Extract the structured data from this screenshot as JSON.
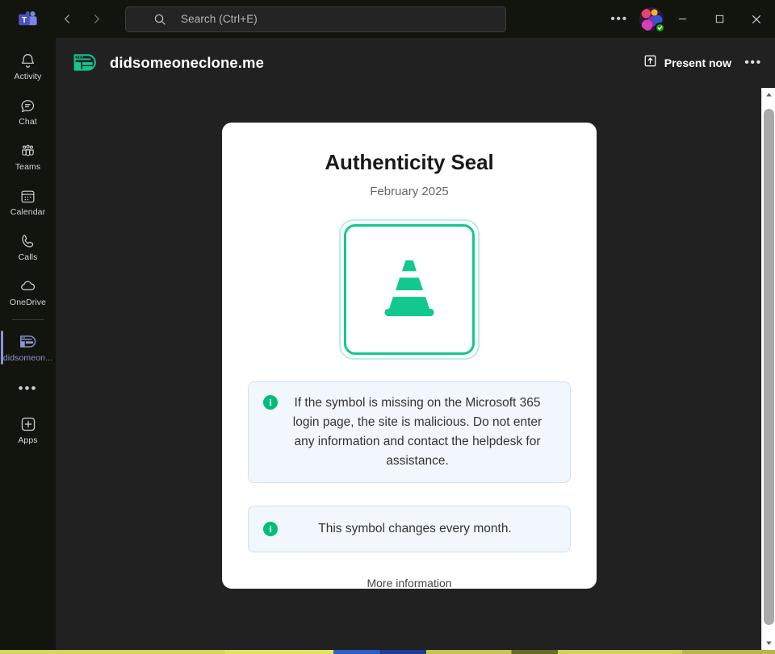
{
  "titlebar": {
    "app_logo": "teams-logo",
    "back_label": "‹",
    "forward_label": "›",
    "search_placeholder": "Search (Ctrl+E)",
    "search_value": "",
    "more_label": "•••",
    "presence_status": "available",
    "minimize_label": "─",
    "maximize_label": "□",
    "close_label": "✕"
  },
  "rail": {
    "items": [
      {
        "label": "Activity",
        "icon": "bell-icon",
        "active": false
      },
      {
        "label": "Chat",
        "icon": "chat-icon",
        "active": false
      },
      {
        "label": "Teams",
        "icon": "teams-icon",
        "active": false
      },
      {
        "label": "Calendar",
        "icon": "calendar-icon",
        "active": false
      },
      {
        "label": "Calls",
        "icon": "phone-icon",
        "active": false
      },
      {
        "label": "OneDrive",
        "icon": "cloud-icon",
        "active": false
      },
      {
        "label": "didsomeon...",
        "icon": "app-window-icon",
        "active": true
      }
    ],
    "more_label": "•••",
    "apps_label": "Apps",
    "accent_color": "#8f93d6"
  },
  "app_header": {
    "title": "didsomeoneclone.me",
    "icon": "app-window-icon",
    "present_label": "Present now",
    "present_icon": "share-up-icon",
    "more_label": "•••"
  },
  "card": {
    "title": "Authenticity Seal",
    "date": "February 2025",
    "seal": {
      "symbol_name": "traffic-cone-icon",
      "color": "#12c88f",
      "outer_border_color": "#b7f0dc"
    },
    "alerts": [
      {
        "icon": "info-icon",
        "icon_char": "i",
        "text": "If the symbol is missing on the Microsoft 365 login page, the site is malicious. Do not enter any information and contact the helpdesk for assistance."
      },
      {
        "icon": "info-icon",
        "icon_char": "i",
        "text": "This symbol changes every month."
      }
    ],
    "more_information_label": "More information"
  },
  "scrollbar": {
    "up_arrow": "▲",
    "down_arrow": "▼"
  },
  "colors": {
    "accent_green": "#12c88f",
    "info_green": "#00bd78",
    "alert_bg": "#f1f7fd",
    "alert_border": "#cfe0f0",
    "rail_bg": "#11150e",
    "content_bg": "#212121"
  }
}
